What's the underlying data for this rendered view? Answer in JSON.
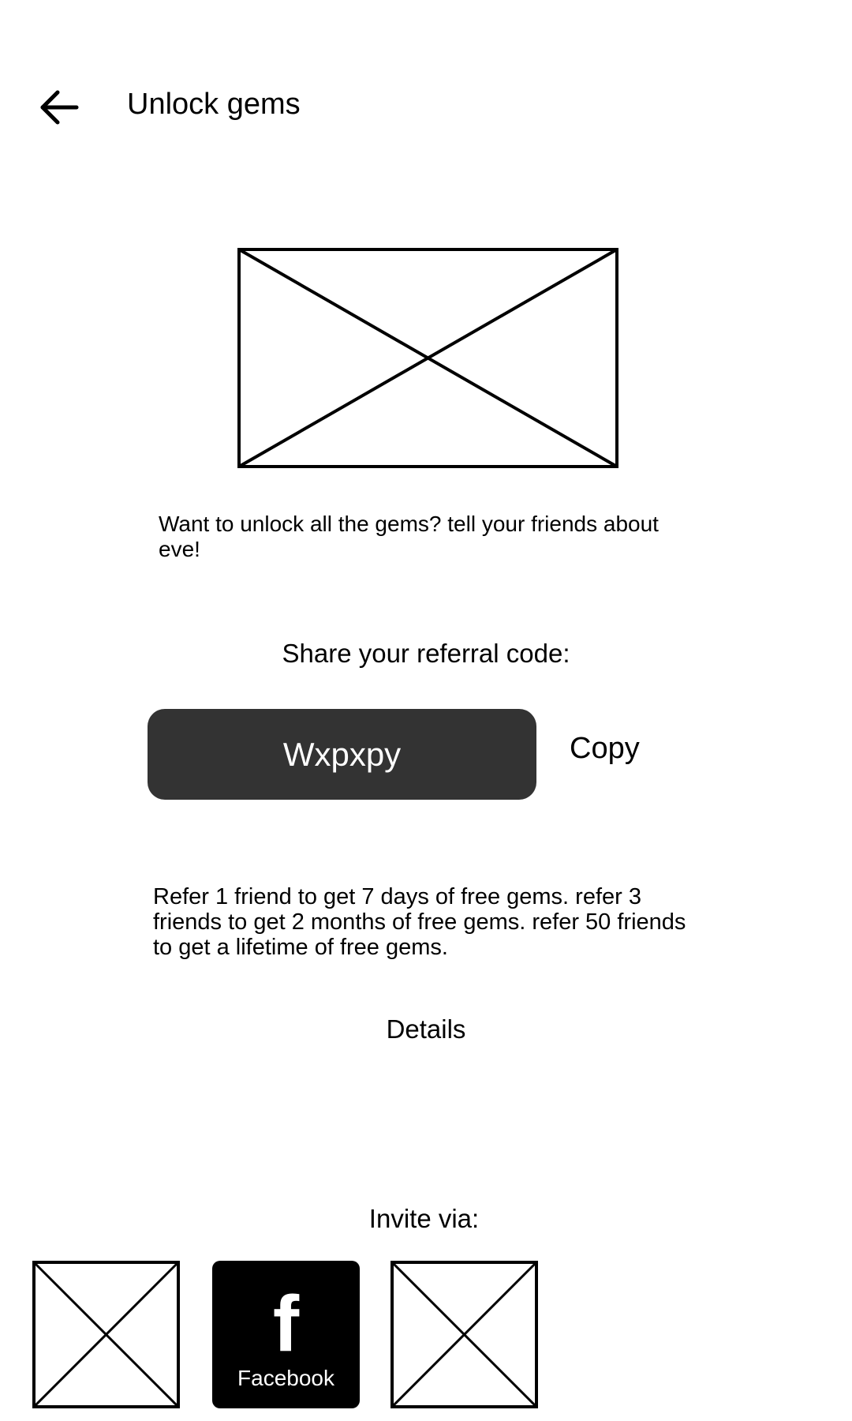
{
  "header": {
    "title": "Unlock gems",
    "back_icon": "arrow-left-icon"
  },
  "intro_text": "Want to unlock all the gems? tell your friends about eve!",
  "referral": {
    "label": "Share your referral code:",
    "code": "Wxpxpy",
    "copy_label": "Copy"
  },
  "reward_text": "Refer 1 friend to get 7 days of free gems. refer 3 friends to get 2 months of free gems. refer 50 friends to get a lifetime of free gems.",
  "details_label": "Details",
  "invite": {
    "label": "Invite via:",
    "options": [
      {
        "name": "",
        "icon": "image-placeholder-icon"
      },
      {
        "name": "Facebook",
        "icon": "facebook-icon",
        "glyph": "f"
      },
      {
        "name": "",
        "icon": "image-placeholder-icon"
      }
    ]
  },
  "colors": {
    "background": "#ffffff",
    "text": "#000000",
    "code_box": "#333333",
    "code_text": "#ffffff",
    "facebook_tile": "#000000"
  }
}
